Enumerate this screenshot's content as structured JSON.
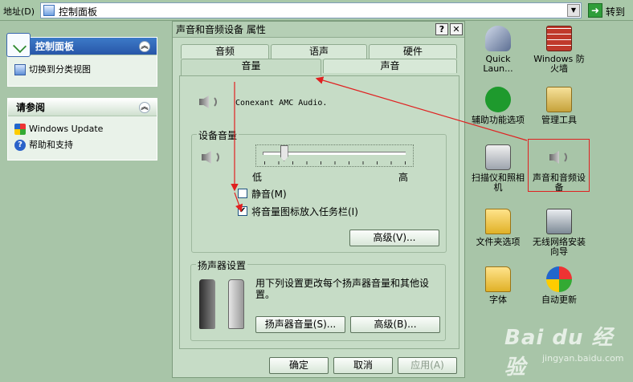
{
  "address_bar": {
    "label": "地址(D)",
    "path": "控制面板",
    "go_label": "转到"
  },
  "left_pane": {
    "control_panel": {
      "title": "控制面板",
      "items": [
        {
          "label": "切换到分类视图",
          "icon": "switch-view-icon"
        }
      ]
    },
    "see_also": {
      "title": "请参阅",
      "items": [
        {
          "label": "Windows Update",
          "icon": "windows-update-icon"
        },
        {
          "label": "帮助和支持",
          "icon": "help-icon"
        }
      ]
    }
  },
  "dialog": {
    "title": "声音和音频设备 属性",
    "tabs_top": [
      "音频",
      "语声",
      "硬件"
    ],
    "tabs_bottom": [
      "音量",
      "声音"
    ],
    "device_name": "Conexant AMC Audio.",
    "device_volume": {
      "group_title": "设备音量",
      "low_label": "低",
      "high_label": "高",
      "level": 0.15,
      "mute_label": "静音(M)",
      "mute_checked": false,
      "tray_label": "将音量图标放入任务栏(I)",
      "tray_checked": true,
      "advanced_label": "高级(V)..."
    },
    "speaker_settings": {
      "group_title": "扬声器设置",
      "description": "用下列设置更改每个扬声器音量和其他设置。",
      "speaker_volume_label": "扬声器音量(S)...",
      "advanced_label": "高级(B)..."
    },
    "buttons": {
      "ok": "确定",
      "cancel": "取消",
      "apply": "应用(A)"
    }
  },
  "right_icons": [
    {
      "label": "Quick Laun...",
      "icon": "rocket-icon"
    },
    {
      "label": "Windows 防火墙",
      "icon": "firewall-icon"
    },
    {
      "label": "辅助功能选项",
      "icon": "accessibility-icon"
    },
    {
      "label": "管理工具",
      "icon": "admin-tools-icon"
    },
    {
      "label": "扫描仪和照相机",
      "icon": "scanner-icon"
    },
    {
      "label": "声音和音频设备",
      "icon": "speaker-icon"
    },
    {
      "label": "文件夹选项",
      "icon": "folder-options-icon"
    },
    {
      "label": "无线网络安装向导",
      "icon": "wireless-icon"
    },
    {
      "label": "字体",
      "icon": "fonts-icon"
    },
    {
      "label": "自动更新",
      "icon": "auto-update-icon"
    }
  ],
  "watermark": {
    "brand": "Bai du 经验",
    "url": "jingyan.baidu.com"
  },
  "colors": {
    "annotation_red": "#e02020",
    "theme_green": "#a8c5a8"
  }
}
